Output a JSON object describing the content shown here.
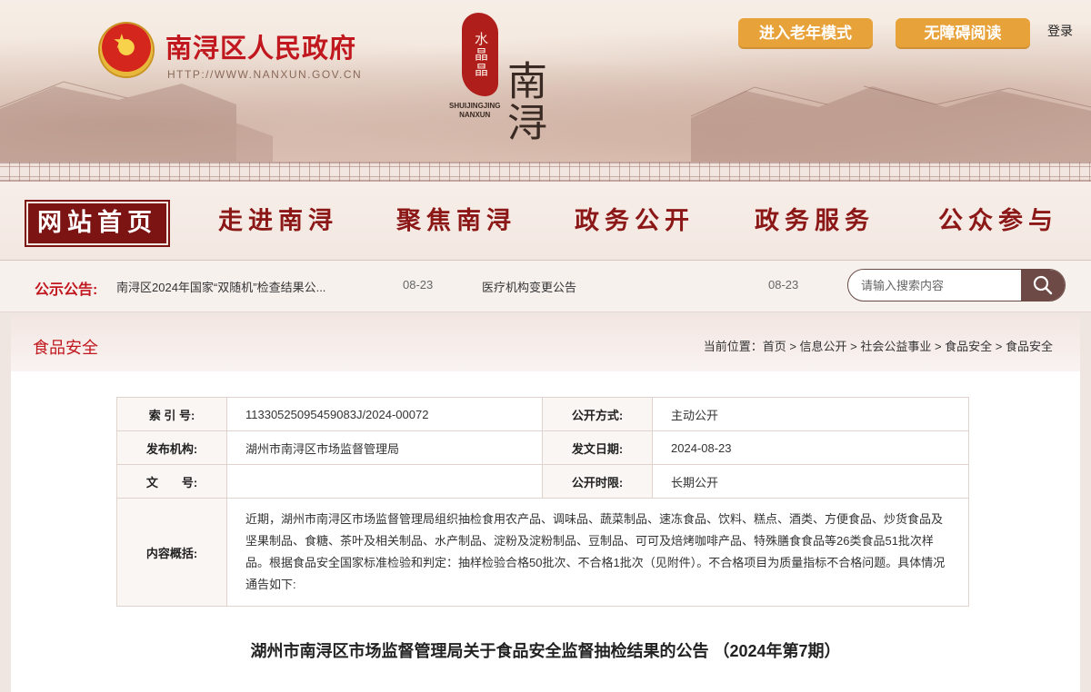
{
  "header": {
    "site_name": "南浔区人民政府",
    "site_url": "HTTP://WWW.NANXUN.GOV.CN",
    "brand_seal": "水晶晶",
    "brand_big": "南浔",
    "brand_en_1": "SHUIJINGJING",
    "brand_en_2": "NANXUN",
    "elderly_mode": "进入老年模式",
    "accessible_read": "无障碍阅读",
    "login": "登录"
  },
  "nav": {
    "items": [
      "网站首页",
      "走进南浔",
      "聚焦南浔",
      "政务公开",
      "政务服务",
      "公众参与"
    ]
  },
  "notice": {
    "label": "公示公告:",
    "items": [
      {
        "title": "南浔区2024年国家“双随机”检查结果公...",
        "date": "08-23"
      },
      {
        "title": "医疗机构变更公告",
        "date": "08-23"
      }
    ]
  },
  "search": {
    "placeholder": "请输入搜索内容"
  },
  "section": {
    "title": "食品安全",
    "breadcrumb": "当前位置：首页 > 信息公开 > 社会公益事业 > 食品安全 > 食品安全"
  },
  "meta": {
    "index_label": "索 引 号:",
    "index_value": "11330525095459083J/2024-00072",
    "open_mode_label": "公开方式:",
    "open_mode_value": "主动公开",
    "publisher_label": "发布机构:",
    "publisher_value": "湖州市南浔区市场监督管理局",
    "date_label": "发文日期:",
    "date_value": "2024-08-23",
    "doc_no_label": "文　　号:",
    "doc_no_value": "",
    "open_term_label": "公开时限:",
    "open_term_value": "长期公开",
    "summary_label": "内容概括:",
    "summary_value": "近期，湖州市南浔区市场监督管理局组织抽检食用农产品、调味品、蔬菜制品、速冻食品、饮料、糕点、酒类、方便食品、炒货食品及坚果制品、食糖、茶叶及相关制品、水产制品、淀粉及淀粉制品、豆制品、可可及焙烤咖啡产品、特殊膳食食品等26类食品51批次样品。根据食品安全国家标准检验和判定：抽样检验合格50批次、不合格1批次（见附件）。不合格项目为质量指标不合格问题。具体情况通告如下:"
  },
  "article": {
    "title": "湖州市南浔区市场监督管理局关于食品安全监督抽检结果的公告 （2024年第7期）"
  },
  "colors": {
    "accent_red": "#c1171e",
    "nav_dark": "#7d1414",
    "button_orange": "#e8a23a",
    "search_button": "#6e4a46"
  }
}
